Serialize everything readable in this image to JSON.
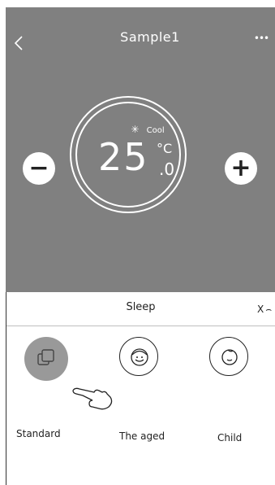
{
  "header": {
    "back_icon": "chevron-left-icon",
    "title": "Sample1",
    "more_label": "•••"
  },
  "climate": {
    "mode_icon": "snowflake-icon",
    "mode_glyph": "✳",
    "mode": "Cool",
    "temperature": "25",
    "unit": "°C",
    "decimal_dot": ".",
    "decimal": "0",
    "minus_label": "−",
    "plus_label": "+"
  },
  "sleep": {
    "title": "Sleep",
    "close_label": "X",
    "close_curl": "⌢",
    "options": [
      {
        "label": "Standard",
        "icon": "copy-squares-icon",
        "selected": true
      },
      {
        "label": "The aged",
        "icon": "elder-face-icon",
        "selected": false
      },
      {
        "label": "Child",
        "icon": "child-face-icon",
        "selected": false
      }
    ]
  },
  "colors": {
    "panel_bg": "#808080",
    "selected_option": "#999999",
    "foreground": "#ffffff"
  }
}
